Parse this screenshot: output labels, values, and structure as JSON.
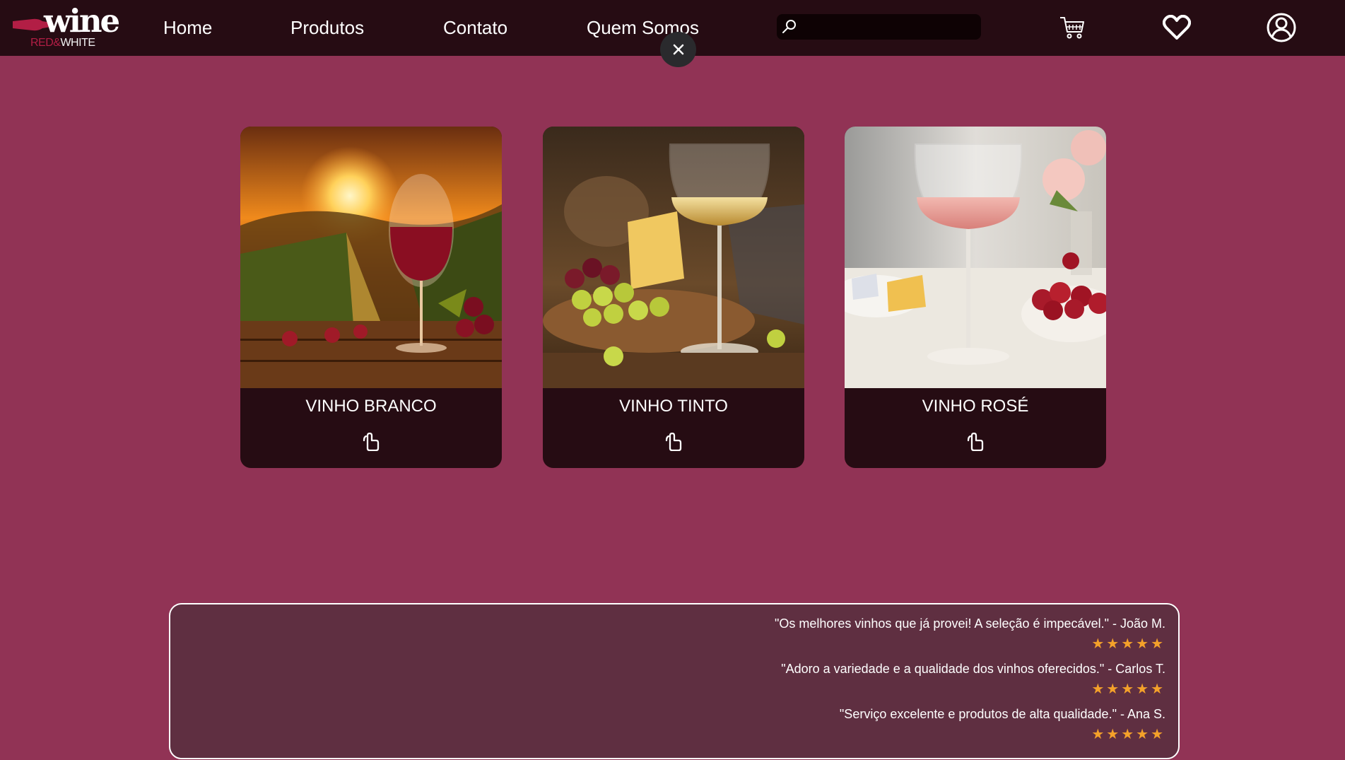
{
  "brand": {
    "logo_word": "wine",
    "logo_sub_red": "RED&",
    "logo_sub_white": "WHITE"
  },
  "nav": {
    "items": [
      "Home",
      "Produtos",
      "Contato",
      "Quem Somos"
    ]
  },
  "search": {
    "placeholder": "",
    "value": ""
  },
  "header_icons": [
    "cart-icon",
    "heart-icon",
    "user-icon",
    "close-icon",
    "search-icon"
  ],
  "cards": [
    {
      "title": "VINHO BRANCO",
      "icon": "tap-icon"
    },
    {
      "title": "VINHO TINTO",
      "icon": "tap-icon"
    },
    {
      "title": "VINHO ROSÉ",
      "icon": "tap-icon"
    }
  ],
  "reviews": [
    {
      "text": "\"Os melhores vinhos que já provei! A seleção é impecável.\" - João M.",
      "stars": "★★★★★",
      "rating": 5
    },
    {
      "text": "\"Adoro a variedade e a qualidade dos vinhos oferecidos.\" - Carlos T.",
      "stars": "★★★★★",
      "rating": 5
    },
    {
      "text": "\"Serviço excelente e produtos de alta qualidade.\" - Ana S.",
      "stars": "★★★★★",
      "rating": 5
    }
  ],
  "colors": {
    "background": "#913355",
    "navbar": "#260c13",
    "card": "#260c13",
    "reviews_panel": "#5f2f41",
    "star": "#f4a12a",
    "brand_red": "#b21e45"
  }
}
